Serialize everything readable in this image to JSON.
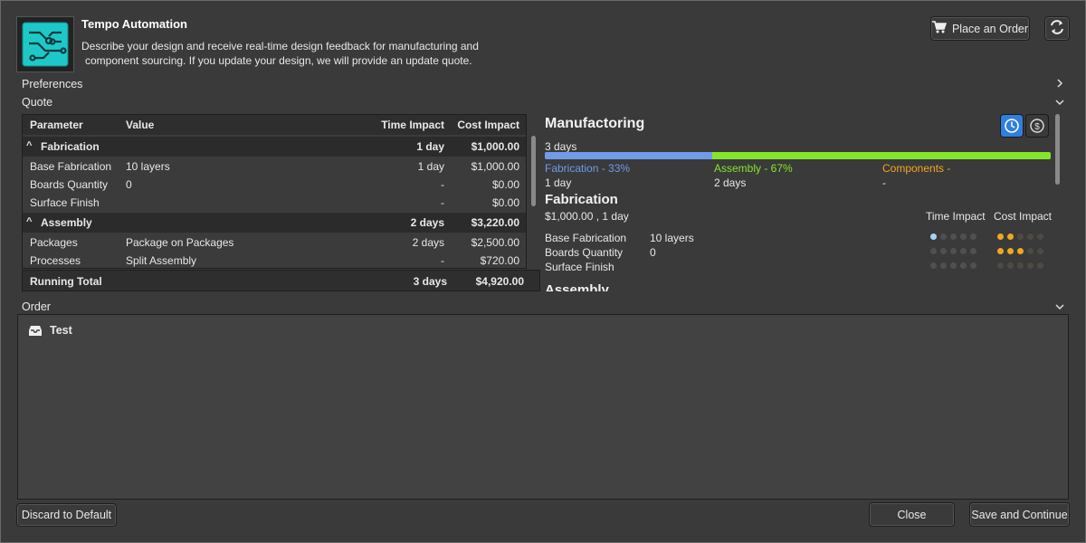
{
  "header": {
    "title": "Tempo Automation",
    "description_line1": "Describe your design and receive real-time design feedback for manufacturing and",
    "description_line2": "component sourcing. If you update your design, we will provide an update quote.",
    "place_order_label": "Place an Order",
    "logo_icon": "circuit-board-icon",
    "swap_icon": "swap-arrows-icon"
  },
  "sections": {
    "preferences": "Preferences",
    "quote": "Quote",
    "order": "Order"
  },
  "quote_table": {
    "columns": [
      "Parameter",
      "Value",
      "Time Impact",
      "Cost Impact"
    ],
    "groups": [
      {
        "name": "Fabrication",
        "time": "1 day",
        "cost": "$1,000.00",
        "rows": [
          {
            "param": "Base Fabrication",
            "value": "10 layers",
            "time": "1 day",
            "cost": "$1,000.00"
          },
          {
            "param": "Boards Quantity",
            "value": "0",
            "time": "-",
            "cost": "$0.00"
          },
          {
            "param": "Surface Finish",
            "value": "",
            "time": "-",
            "cost": "$0.00"
          }
        ]
      },
      {
        "name": "Assembly",
        "time": "2 days",
        "cost": "$3,220.00",
        "rows": [
          {
            "param": "Packages",
            "value": "Package on Packages",
            "time": "2 days",
            "cost": "$2,500.00"
          },
          {
            "param": "Processes",
            "value": "Split Assembly",
            "time": "-",
            "cost": "$720.00"
          }
        ]
      }
    ],
    "running_total": {
      "label": "Running Total",
      "time": "3 days",
      "cost": "$4,920.00"
    }
  },
  "manufacturing": {
    "title": "Manufactoring",
    "total_days": "3 days",
    "fabrication_fraction": 0.33,
    "assembly_fraction": 0.67,
    "legend": [
      {
        "label": "Fabrication  -  33%",
        "sub": "1 day",
        "color": "#6f9bea"
      },
      {
        "label": "Assembly  -  67%",
        "sub": "2 days",
        "color": "#84e62a"
      },
      {
        "label": "Components  -",
        "sub": "-",
        "color": "#f2a71d"
      }
    ],
    "toggle_icons": [
      "clock-icon",
      "dollar-icon"
    ],
    "fabrication": {
      "title": "Fabrication",
      "summary": "$1,000.00 ,  1 day",
      "time_impact_label": "Time Impact",
      "cost_impact_label": "Cost Impact",
      "params": [
        {
          "param": "Base Fabrication",
          "value": "10 layers",
          "time_level": 1,
          "cost_level": 2
        },
        {
          "param": "Boards Quantity",
          "value": "0",
          "time_level": 0,
          "cost_level": 3
        },
        {
          "param": "Surface Finish",
          "value": "",
          "time_level": 0,
          "cost_level": 0
        }
      ]
    },
    "next_section_title": "Assembly"
  },
  "order": {
    "item_label": "Test",
    "item_icon": "inbox-icon"
  },
  "buttons": {
    "discard": "Discard to Default",
    "close": "Close",
    "save": "Save and Continue"
  },
  "colors": {
    "accent_blue": "#2f7fe0",
    "time_dot": "#a8d4f0",
    "cost_dot": "#f2a71d"
  }
}
